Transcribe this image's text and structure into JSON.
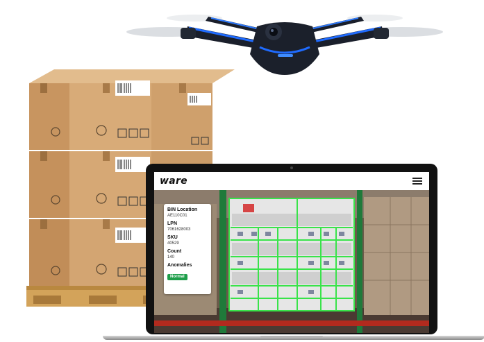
{
  "app": {
    "brand": "ware"
  },
  "info_card": {
    "bin_location_label": "BIN Location",
    "bin_location_value": "AE110C01",
    "lpn_label": "LPN",
    "lpn_value": "7061628003",
    "sku_label": "SKU",
    "sku_value": "40529",
    "count_label": "Count",
    "count_value": "140",
    "anomalies_label": "Anomalies",
    "anomalies_status": "Normal"
  },
  "colors": {
    "drone_accent": "#1f6bff",
    "detection_box": "#39e34a",
    "status_normal": "#1e9e4a",
    "cardboard": "#d5a772",
    "rack_green": "#1f7a3a",
    "rack_red": "#b22a1e"
  },
  "icons": {
    "menu": "hamburger-menu-icon",
    "recycle": "recycle-icon",
    "handling": "handling-symbols-icon"
  }
}
